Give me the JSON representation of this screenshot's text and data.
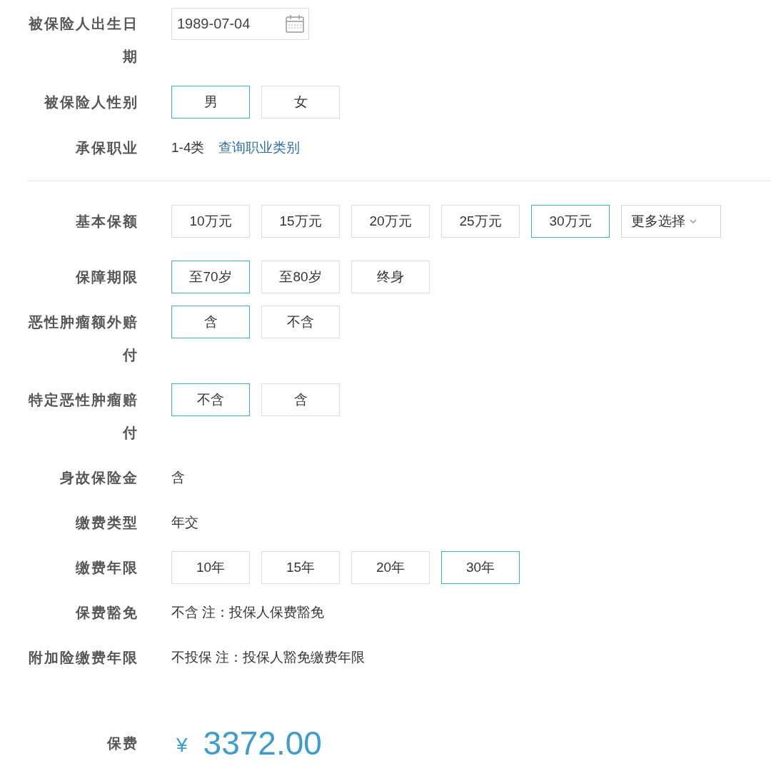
{
  "insured": {
    "fields": [
      {
        "kind": "date",
        "label": "被保险人出生日期",
        "value": "1989-07-04"
      },
      {
        "kind": "options",
        "label": "被保险人性别",
        "options": [
          {
            "label": "男",
            "selected": true
          },
          {
            "label": "女",
            "selected": false
          }
        ]
      },
      {
        "kind": "text",
        "label": "承保职业",
        "value": "1-4类",
        "link": "查询职业类别"
      }
    ]
  },
  "plan": {
    "fields": [
      {
        "kind": "options",
        "label": "基本保额",
        "options": [
          {
            "label": "10万元",
            "selected": false
          },
          {
            "label": "15万元",
            "selected": false
          },
          {
            "label": "20万元",
            "selected": false
          },
          {
            "label": "25万元",
            "selected": false
          },
          {
            "label": "30万元",
            "selected": true
          }
        ],
        "more": "更多选择"
      },
      {
        "kind": "options",
        "label": "保障期限",
        "options": [
          {
            "label": "至70岁",
            "selected": true
          },
          {
            "label": "至80岁",
            "selected": false
          },
          {
            "label": "终身",
            "selected": false
          }
        ]
      },
      {
        "kind": "options",
        "label": "恶性肿瘤额外赔付",
        "options": [
          {
            "label": "含",
            "selected": true
          },
          {
            "label": "不含",
            "selected": false
          }
        ]
      },
      {
        "kind": "options",
        "label": "特定恶性肿瘤赔付",
        "options": [
          {
            "label": "不含",
            "selected": true
          },
          {
            "label": "含",
            "selected": false
          }
        ]
      },
      {
        "kind": "text",
        "label": "身故保险金",
        "value": "含"
      },
      {
        "kind": "text",
        "label": "缴费类型",
        "value": "年交"
      },
      {
        "kind": "options",
        "label": "缴费年限",
        "options": [
          {
            "label": "10年",
            "selected": false
          },
          {
            "label": "15年",
            "selected": false
          },
          {
            "label": "20年",
            "selected": false
          },
          {
            "label": "30年",
            "selected": true
          }
        ]
      },
      {
        "kind": "text",
        "label": "保费豁免",
        "value": "不含 注：投保人保费豁免"
      },
      {
        "kind": "text",
        "label": "附加险缴费年限",
        "value": "不投保 注：投保人豁免缴费年限"
      }
    ]
  },
  "premium": {
    "label": "保费",
    "currency": "¥",
    "amount": "3372.00"
  }
}
